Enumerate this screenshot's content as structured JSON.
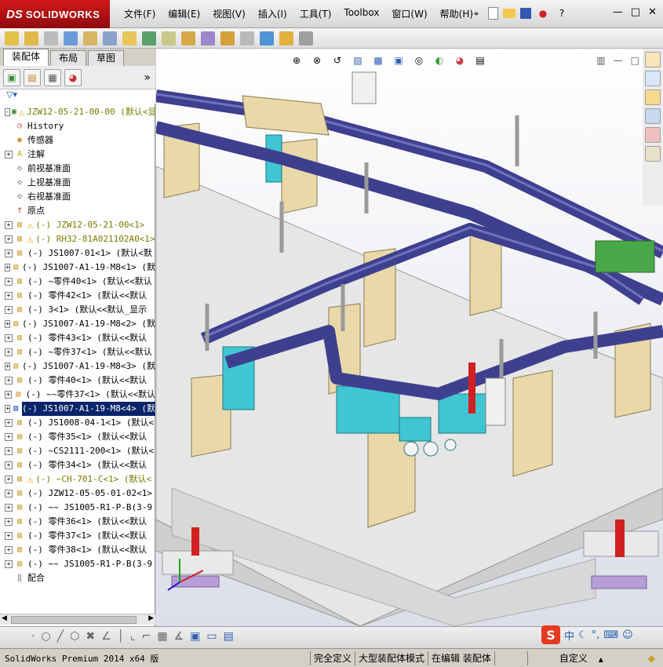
{
  "titlebar": {
    "logo_ds": "DS",
    "logo_text": "SOLIDWORKS",
    "menu": [
      "文件(F)",
      "编辑(E)",
      "视图(V)",
      "插入(I)",
      "工具(T)",
      "Toolbox",
      "窗口(W)",
      "帮助(H)"
    ],
    "help_glyph": "?"
  },
  "panel": {
    "tabs": [
      "装配体",
      "布局",
      "草图"
    ],
    "active_tab": "装配体",
    "more_glyph": "»"
  },
  "tree": {
    "items": [
      {
        "label": "JZW12-05-21-00-00 (默认<显",
        "icon": "assembly-icon",
        "warning": true,
        "yellow": true,
        "expander": "-"
      },
      {
        "label": "History",
        "icon": "history-icon",
        "warning": false,
        "expander": ""
      },
      {
        "label": "传感器",
        "icon": "sensor-icon",
        "warning": false,
        "expander": ""
      },
      {
        "label": "注解",
        "icon": "annotation-icon",
        "warning": false,
        "expander": "+"
      },
      {
        "label": "前视基准面",
        "icon": "plane-icon",
        "warning": false,
        "expander": ""
      },
      {
        "label": "上视基准面",
        "icon": "plane-icon",
        "warning": false,
        "expander": ""
      },
      {
        "label": "右视基准面",
        "icon": "plane-icon",
        "warning": false,
        "expander": ""
      },
      {
        "label": "原点",
        "icon": "origin-icon",
        "warning": false,
        "expander": ""
      },
      {
        "label": "(-) JZW12-05-21-00<1>",
        "icon": "part-icon",
        "warning": true,
        "yellow": true,
        "expander": "+"
      },
      {
        "label": "(-) RH32-81A021102A0<1>",
        "icon": "part-icon",
        "warning": true,
        "yellow": true,
        "expander": "+"
      },
      {
        "label": "(-) JS1007-01<1> (默认<默",
        "icon": "part-icon",
        "warning": false,
        "expander": "+"
      },
      {
        "label": "(-) JS1007-A1-19-M8<1> (默",
        "icon": "part-icon",
        "warning": false,
        "expander": "+"
      },
      {
        "label": "(-) ~零件40<1> (默认<<默认",
        "icon": "part-icon",
        "warning": false,
        "expander": "+"
      },
      {
        "label": "(-) 零件42<1> (默认<<默认",
        "icon": "part-icon",
        "warning": false,
        "expander": "+"
      },
      {
        "label": "(-) 3<1> (默认<<默认_显示",
        "icon": "part-icon",
        "warning": false,
        "expander": "+"
      },
      {
        "label": "(-) JS1007-A1-19-M8<2> (默",
        "icon": "part-icon",
        "warning": false,
        "expander": "+"
      },
      {
        "label": "(-) 零件43<1> (默认<<默认",
        "icon": "part-icon",
        "warning": false,
        "expander": "+"
      },
      {
        "label": "(-) ~零件37<1> (默认<<默认",
        "icon": "part-icon",
        "warning": false,
        "expander": "+"
      },
      {
        "label": "(-) JS1007-A1-19-M8<3> (默",
        "icon": "part-icon",
        "warning": false,
        "expander": "+"
      },
      {
        "label": "(-) 零件40<1> (默认<<默认",
        "icon": "part-icon",
        "warning": false,
        "expander": "+"
      },
      {
        "label": "(-) ~~零件37<1> (默认<<默认",
        "icon": "part-icon",
        "warning": false,
        "expander": "+"
      },
      {
        "label": "(-) JS1007-A1-19-M8<4> (默",
        "icon": "part-icon",
        "warning": false,
        "expander": "+",
        "selected": true
      },
      {
        "label": "(-) JS1008-04-1<1> (默认<",
        "icon": "part-icon",
        "warning": false,
        "expander": "+"
      },
      {
        "label": "(-) 零件35<1> (默认<<默认",
        "icon": "part-icon",
        "warning": false,
        "expander": "+"
      },
      {
        "label": "(-) ~CS2111-200<1> (默认<",
        "icon": "part-icon",
        "warning": false,
        "expander": "+"
      },
      {
        "label": "(-) 零件34<1> (默认<<默认",
        "icon": "part-icon",
        "warning": false,
        "expander": "+"
      },
      {
        "label": "(-) ~CH-701-C<1> (默认<",
        "icon": "part-icon",
        "warning": true,
        "yellow": true,
        "expander": "+"
      },
      {
        "label": "(-) JZW12-05-05-01-02<1>",
        "icon": "part-icon",
        "warning": false,
        "expander": "+"
      },
      {
        "label": "(-) ~~ JS1005-R1-P-B(3-9",
        "icon": "part-icon",
        "warning": false,
        "expander": "+"
      },
      {
        "label": "(-) 零件36<1> (默认<<默认",
        "icon": "part-icon",
        "warning": false,
        "expander": "+"
      },
      {
        "label": "(-) 零件37<1> (默认<<默认",
        "icon": "part-icon",
        "warning": false,
        "expander": "+"
      },
      {
        "label": "(-) 零件38<1> (默认<<默认",
        "icon": "part-icon",
        "warning": false,
        "expander": "+"
      },
      {
        "label": "(-) ~~ JS1005-R1-P-B(3-9",
        "icon": "part-icon",
        "warning": false,
        "expander": "+"
      },
      {
        "label": "配合",
        "icon": "mates-icon",
        "warning": false,
        "expander": ""
      }
    ]
  },
  "status": {
    "product": "SolidWorks Premium 2014 x64 版",
    "defined": "完全定义",
    "mode": "大型装配体模式",
    "editing": "在编辑 装配体",
    "units": "自定义",
    "units_arrow": "▲"
  },
  "ime": {
    "logo": "S",
    "lang": "中"
  },
  "colors": {
    "brand_red": "#c8141b",
    "frame_blue": "#3f3f8f",
    "block_tan": "#e9d9a8",
    "block_cyan": "#3fc6d2",
    "selection": "#0a246a"
  }
}
